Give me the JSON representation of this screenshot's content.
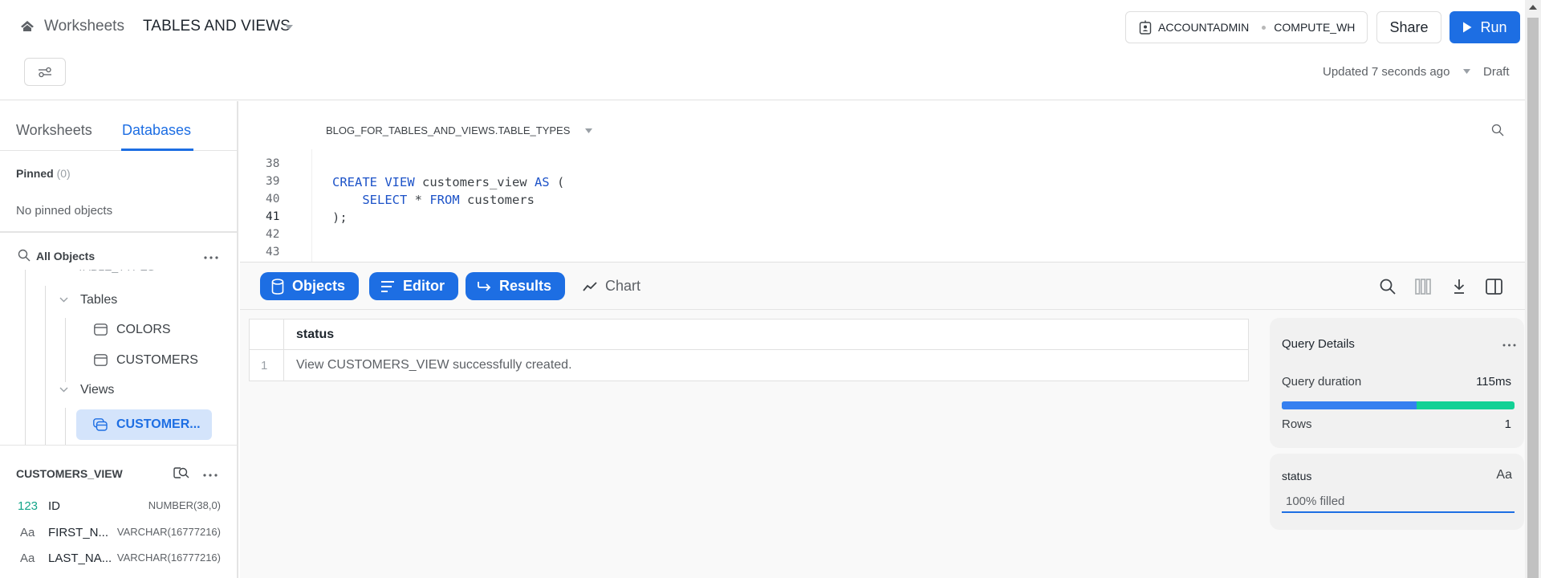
{
  "header": {
    "breadcrumb_root": "Worksheets",
    "worksheet_title": "TABLES AND VIEWS",
    "role": "ACCOUNTADMIN",
    "warehouse": "COMPUTE_WH",
    "share_label": "Share",
    "run_label": "Run",
    "updated_text": "Updated 7 seconds ago",
    "status_text": "Draft"
  },
  "sidebar": {
    "tabs": [
      {
        "label": "Worksheets",
        "active": false
      },
      {
        "label": "Databases",
        "active": true
      }
    ],
    "pinned_label": "Pinned",
    "pinned_count": "(0)",
    "no_pinned_text": "No pinned objects",
    "all_objects_label": "All Objects",
    "tree": {
      "schema_clipped": "TABLE_TYPES",
      "tables_label": "Tables",
      "tables": [
        "COLORS",
        "CUSTOMERS"
      ],
      "views_label": "Views",
      "views": [
        "CUSTOMER..."
      ]
    },
    "object_details": {
      "title": "CUSTOMERS_VIEW",
      "columns": [
        {
          "type_icon": "123",
          "name": "ID",
          "data_type": "NUMBER(38,0)"
        },
        {
          "type_icon": "Aa",
          "name": "FIRST_N...",
          "data_type": "VARCHAR(16777216)"
        },
        {
          "type_icon": "Aa",
          "name": "LAST_NA...",
          "data_type": "VARCHAR(16777216)"
        }
      ]
    }
  },
  "editor": {
    "context_path": "BLOG_FOR_TABLES_AND_VIEWS.TABLE_TYPES",
    "line_numbers": [
      "38",
      "39",
      "40",
      "41",
      "42",
      "43"
    ],
    "active_line": "41",
    "code": {
      "l39_kw1": "CREATE VIEW",
      "l39_text": " customers_view ",
      "l39_kw2": "AS",
      "l39_tail": " (",
      "l40_indent": "    ",
      "l40_kw1": "SELECT",
      "l40_text": " * ",
      "l40_kw2": "FROM",
      "l40_tail": " customers",
      "l41_text": ");"
    }
  },
  "results": {
    "toolbar": {
      "objects_label": "Objects",
      "editor_label": "Editor",
      "results_label": "Results",
      "chart_label": "Chart"
    },
    "table": {
      "columns": [
        "status"
      ],
      "rows": [
        {
          "index": "1",
          "status": "View CUSTOMERS_VIEW successfully created."
        }
      ]
    },
    "query_details": {
      "title": "Query Details",
      "duration_label": "Query duration",
      "duration_value": "115ms",
      "duration_split_fraction": 0.58,
      "rows_label": "Rows",
      "rows_value": "1",
      "colors": {
        "compile": "#3580f0",
        "execute": "#13d195"
      }
    },
    "column_summary": {
      "column": "status",
      "type_icon": "Aa",
      "fill_text": "100% filled"
    }
  },
  "theme": {
    "accent": "#1d6ee3",
    "selection_bg": "#d4e4fb",
    "keyword": "#1d53c8"
  }
}
